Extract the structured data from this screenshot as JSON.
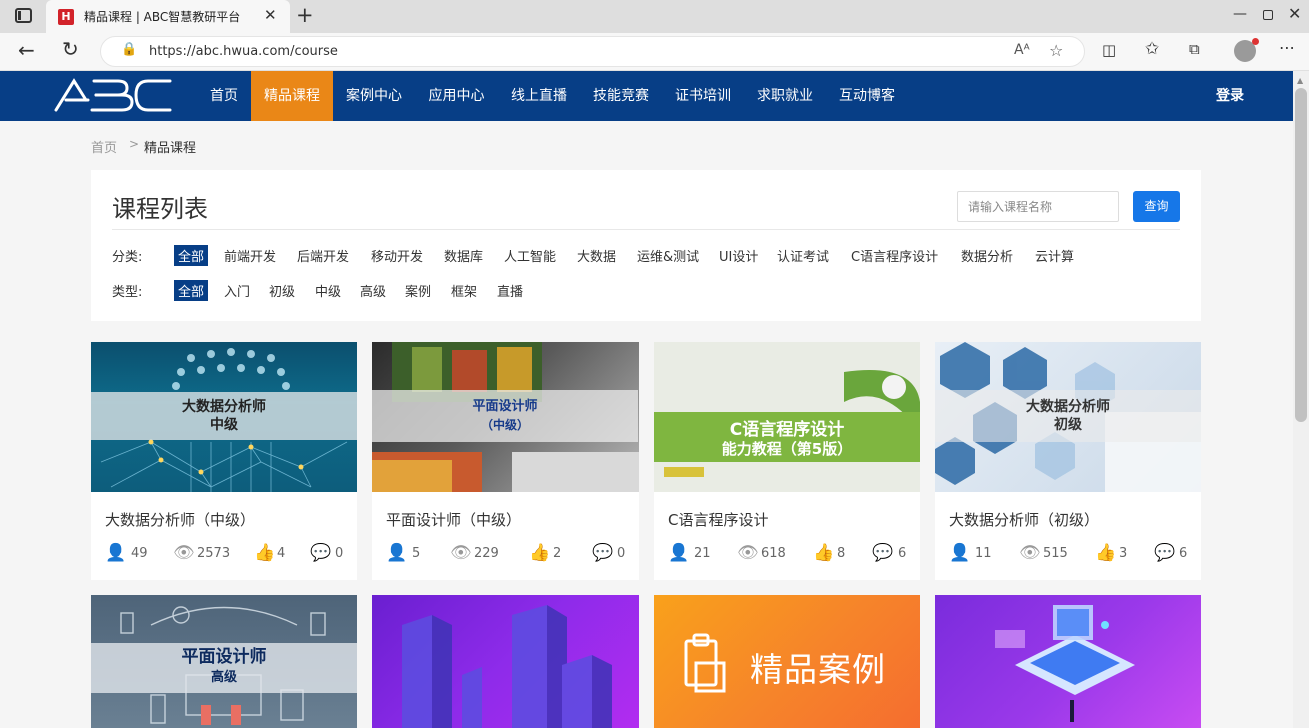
{
  "browser": {
    "tab_title": "精品课程 | ABC智慧教研平台",
    "favicon_letter": "H",
    "url": "https://abc.hwua.com/course"
  },
  "nav": {
    "logo_text": "ABC",
    "items": [
      "首页",
      "精品课程",
      "案例中心",
      "应用中心",
      "线上直播",
      "技能竞赛",
      "证书培训",
      "求职就业",
      "互动博客"
    ],
    "active_index": 1,
    "login": "登录",
    "colors": {
      "bar": "#073e86",
      "active": "#ea8717"
    }
  },
  "breadcrumb": {
    "home": "首页",
    "separator": ">",
    "current": "精品课程"
  },
  "panel": {
    "title": "课程列表",
    "search_placeholder": "请输入课程名称",
    "search_button": "查询",
    "category_label": "分类:",
    "categories": [
      "全部",
      "前端开发",
      "后端开发",
      "移动开发",
      "数据库",
      "人工智能",
      "大数据",
      "运维&测试",
      "UI设计",
      "认证考试",
      "C语言程序设计",
      "数据分析",
      "云计算"
    ],
    "type_label": "类型:",
    "types": [
      "全部",
      "入门",
      "初级",
      "中级",
      "高级",
      "案例",
      "框架",
      "直播"
    ]
  },
  "cards": [
    {
      "title": "大数据分析师（中级）",
      "overlay": [
        "大数据分析师",
        "中级"
      ],
      "students": "49",
      "views": "2573",
      "likes": "4",
      "comments": "0"
    },
    {
      "title": "平面设计师（中级）",
      "overlay": [
        "平面设计师",
        "（中级）"
      ],
      "students": "5",
      "views": "229",
      "likes": "2",
      "comments": "0"
    },
    {
      "title": "C语言程序设计",
      "overlay": [
        "C语言程序设计",
        "能力教程（第5版）"
      ],
      "students": "21",
      "views": "618",
      "likes": "8",
      "comments": "6"
    },
    {
      "title": "大数据分析师（初级）",
      "overlay": [
        "大数据分析师",
        "初级"
      ],
      "students": "11",
      "views": "515",
      "likes": "3",
      "comments": "6"
    }
  ],
  "cards_row2": [
    {
      "overlay": [
        "平面设计师",
        "高级"
      ]
    },
    {
      "overlay": []
    },
    {
      "overlay": [
        "精品案例"
      ]
    },
    {
      "overlay": []
    }
  ]
}
